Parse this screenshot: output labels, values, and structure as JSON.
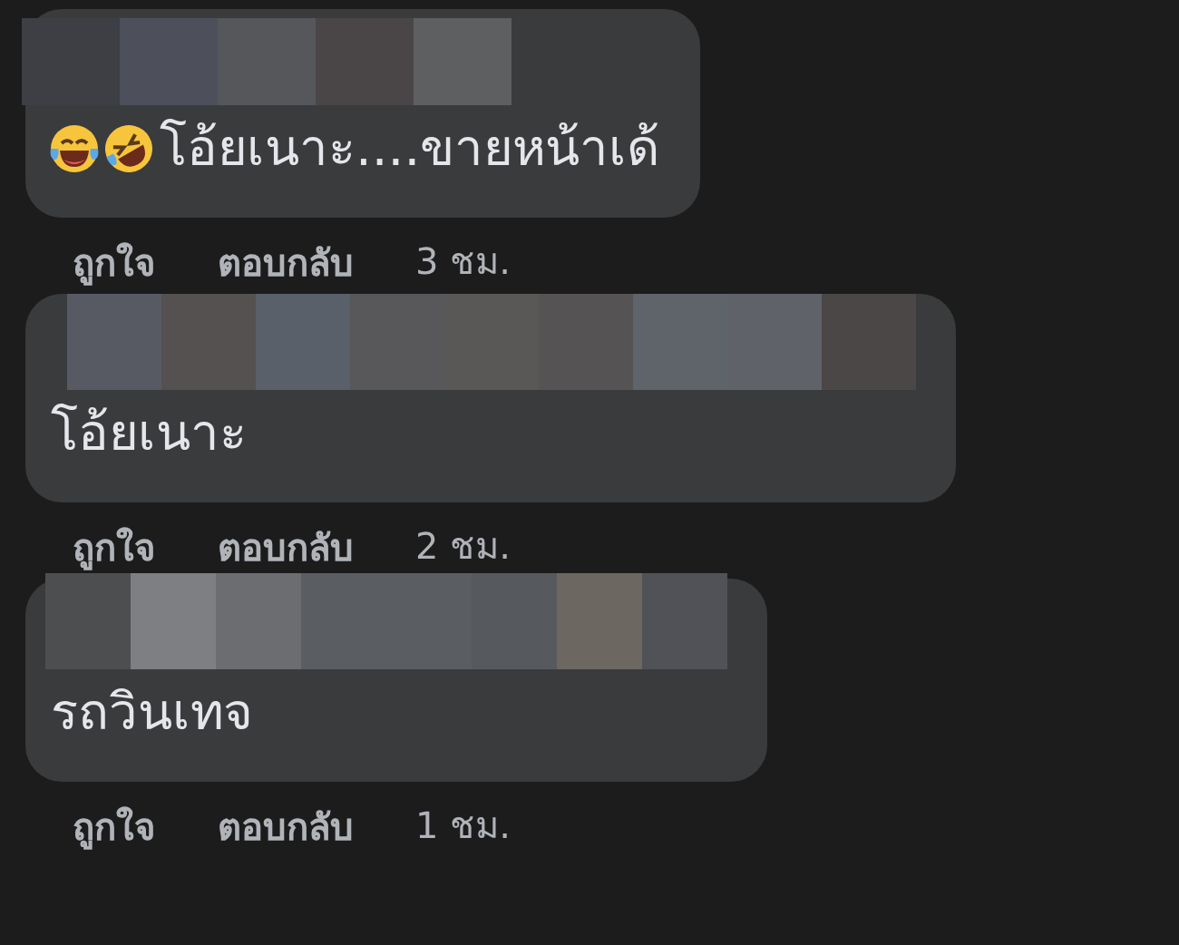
{
  "comments": [
    {
      "kind": "emoji",
      "text": "โอ้ยเนาะ....ขายหน้าเด้",
      "actions": [
        {
          "label": "ถูกใจ"
        },
        {
          "label": "ตอบกลับ"
        }
      ],
      "time": "3 ชม."
    },
    {
      "kind": "plain",
      "text": "โอ้ยเนาะ",
      "actions": [
        {
          "label": "ถูกใจ"
        },
        {
          "label": "ตอบกลับ"
        }
      ],
      "time": "2 ชม."
    },
    {
      "kind": "plain",
      "text": "รถวินเทจ",
      "actions": [
        {
          "label": "ถูกใจ"
        },
        {
          "label": "ตอบกลับ"
        }
      ],
      "time": "1 ชม."
    }
  ]
}
